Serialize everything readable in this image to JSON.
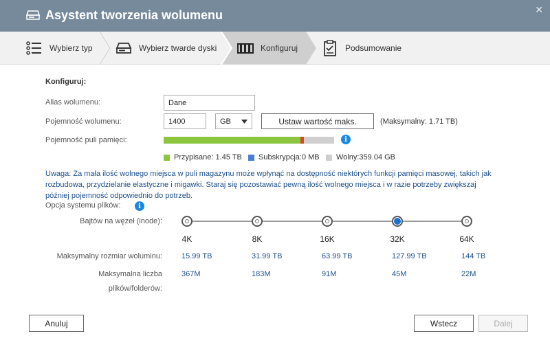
{
  "window": {
    "title": "Asystent tworzenia wolumenu",
    "close": "✕"
  },
  "steps": [
    {
      "label": "Wybierz typ",
      "icon": "list-icon"
    },
    {
      "label": "Wybierz twarde dyski",
      "icon": "disk-icon"
    },
    {
      "label": "Konfiguruj",
      "icon": "book-icon"
    },
    {
      "label": "Podsumowanie",
      "icon": "clipboard-icon"
    }
  ],
  "section_title": "Konfiguruj:",
  "alias": {
    "label": "Alias wolumenu:",
    "value": "Dane"
  },
  "capacity": {
    "label": "Pojemność wolumenu:",
    "value": "1400",
    "unit": "GB",
    "max_button": "Ustaw wartość maks.",
    "max_note": "(Maksymalny: 1.71 TB)"
  },
  "pool": {
    "label": "Pojemność puli pamięci:",
    "used_fraction": 0.805,
    "subscribed_fraction": 0.02,
    "legend": {
      "allocated": "Przypisane:  1.45 TB",
      "subscription": "Subskrypcja:0 MB",
      "free": "Wolny:359.04 GB"
    },
    "colors": {
      "allocated": "#8cc63f",
      "subscription": "#4a7fd4",
      "free": "#cfcfcf",
      "marker": "#d9452b"
    }
  },
  "warning": "Uwaga: Za mała ilość wolnego miejsca w puli magazynu może wpłynąć na dostępność niektórych funkcji pamięci masowej, takich jak rozbudowa, przydzielanie elastyczne i migawki. Staraj się pozostawiać pewną ilość wolnego miejsca i w razie potrzeby zwiększaj później pojemność odpowiednio do potrzeb.",
  "filesystem": {
    "label": "Opcja systemu plików:",
    "bytes_label": "Bajtów na węzeł (inode):",
    "max_size_label": "Maksymalny rozmiar woluminu:",
    "max_files_label_1": "Maksymalna liczba",
    "max_files_label_2": "plików/folderów:",
    "options": [
      {
        "size": "4K",
        "max_size": "15.99 TB",
        "max_files": "367M",
        "selected": false
      },
      {
        "size": "8K",
        "max_size": "31.99 TB",
        "max_files": "183M",
        "selected": false
      },
      {
        "size": "16K",
        "max_size": "63.99 TB",
        "max_files": "91M",
        "selected": false
      },
      {
        "size": "32K",
        "max_size": "127.99 TB",
        "max_files": "45M",
        "selected": true
      },
      {
        "size": "64K",
        "max_size": "144 TB",
        "max_files": "22M",
        "selected": false
      }
    ]
  },
  "buttons": {
    "cancel": "Anuluj",
    "back": "Wstecz",
    "next": "Dalej"
  }
}
